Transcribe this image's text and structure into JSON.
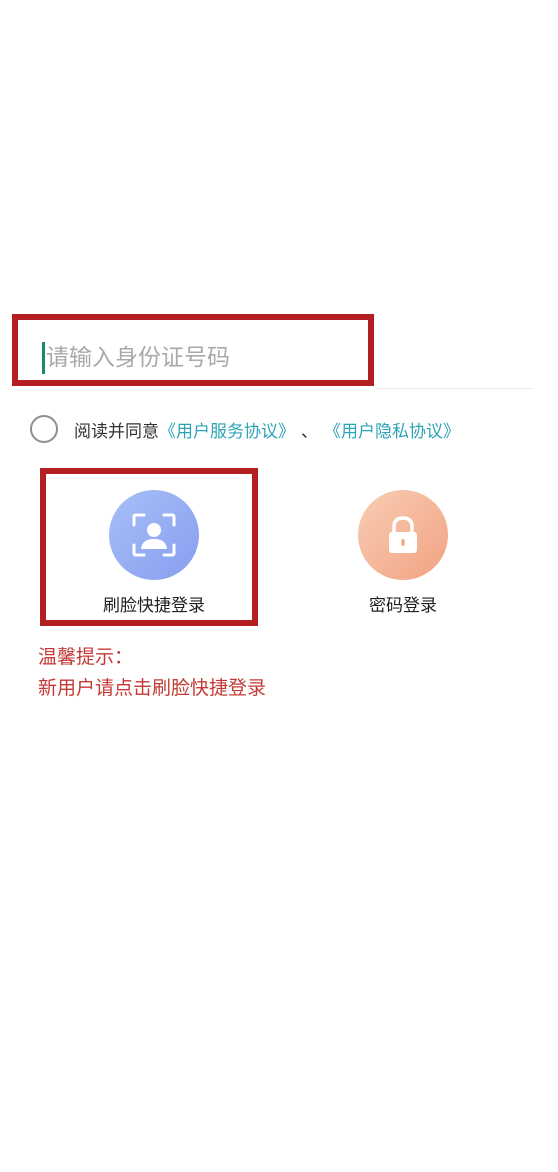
{
  "login": {
    "id_input": {
      "placeholder": "请输入身份证号码",
      "value": ""
    },
    "agreement": {
      "prefix": "阅读并同意",
      "service_link": "《用户服务协议》",
      "separator": "、",
      "privacy_link": "《用户隐私协议》",
      "checked": false
    },
    "options": {
      "face_label": "刷脸快捷登录",
      "face_icon": "face-scan-icon",
      "password_label": "密码登录",
      "password_icon": "lock-icon"
    },
    "tip": {
      "title": "温馨提示：",
      "body": "新用户请点击刷脸快捷登录"
    }
  },
  "colors": {
    "highlight_border": "#b42022",
    "link": "#2da3b8",
    "tip_text": "#c33a34",
    "face_gradient_start": "#a8bff7",
    "face_gradient_end": "#879ef0",
    "password_gradient_start": "#f8cdb4",
    "password_gradient_end": "#f2a282",
    "cursor": "#1a8a6d"
  }
}
